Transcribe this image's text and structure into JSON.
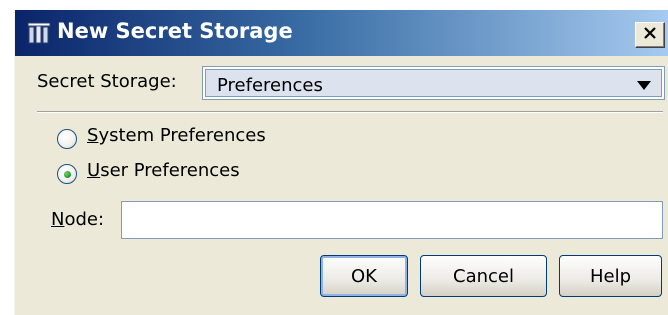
{
  "window": {
    "title": "New Secret Storage"
  },
  "secret_storage": {
    "label": "Secret Storage:",
    "selected": "Preferences"
  },
  "radios": [
    {
      "label_u": "S",
      "label_rest": "ystem Preferences",
      "checked": false
    },
    {
      "label_u": "U",
      "label_rest": "ser Preferences",
      "checked": true
    }
  ],
  "node": {
    "label_u": "N",
    "label_rest": "ode:",
    "value": ""
  },
  "buttons": {
    "ok": "OK",
    "cancel": "Cancel",
    "help": "Help"
  },
  "icons": {
    "app": "secret-storage-icon",
    "close": "close-icon",
    "dropdown": "chevron-down-icon"
  },
  "colors": {
    "title_bar_start": "#0a246a",
    "title_bar_end": "#a6caf0",
    "dialog_bg": "#ece9d8",
    "radio_selected": "#21a121",
    "button_border": "#003c74"
  }
}
